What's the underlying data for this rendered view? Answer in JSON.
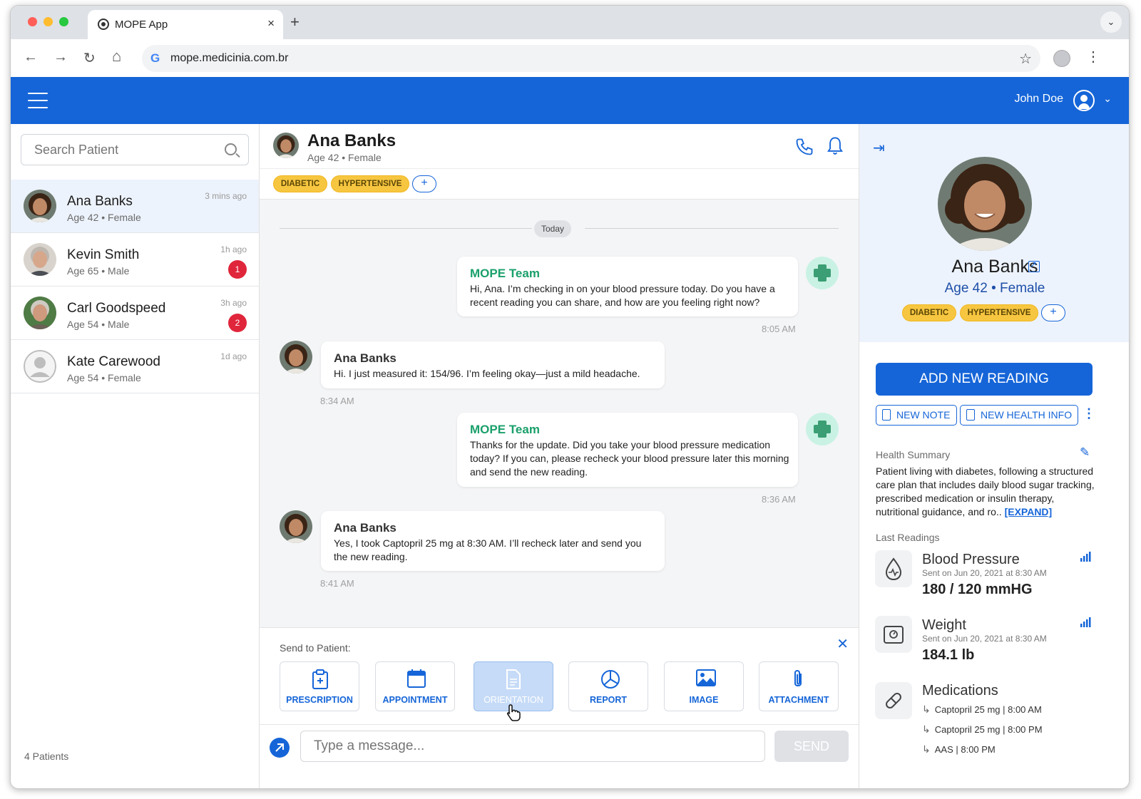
{
  "browser": {
    "tab_title": "MOPE App",
    "tab_close": "×",
    "new_tab": "+",
    "url": "mope.medicinia.com.br",
    "back": "←",
    "forward": "→",
    "reload": "↻",
    "home": "⌂",
    "star": "☆",
    "menu": "⋮",
    "tabs_menu": "⌄"
  },
  "header": {
    "user_name": "John Doe",
    "chevron": "⌄"
  },
  "sidebar": {
    "search": {
      "placeholder": "Search Patient"
    },
    "patients": [
      {
        "name": "Ana Banks",
        "info": "Age 42 • Female",
        "time": "3 mins ago",
        "badge": ""
      },
      {
        "name": "Kevin Smith",
        "info": "Age 65 • Male",
        "time": "1h ago",
        "badge": "1"
      },
      {
        "name": "Carl Goodspeed",
        "info": "Age 54 • Male",
        "time": "3h ago",
        "badge": "2"
      },
      {
        "name": "Kate Carewood",
        "info": "Age 54 • Female",
        "time": "1d ago",
        "badge": ""
      }
    ],
    "count_label": "4 Patients"
  },
  "chat": {
    "patient_name": "Ana Banks",
    "patient_info": "Age 42 • Female",
    "tags": [
      "DIABETIC",
      "HYPERTENSIVE"
    ],
    "tag_add": "+",
    "day_label": "Today",
    "messages": [
      {
        "sender": "MOPE Team",
        "text": "Hi, Ana. I’m checking in on your blood pressure today. Do you have a recent reading you can share, and how are you feeling right now?",
        "time": "8:05 AM"
      },
      {
        "sender": "Ana Banks",
        "text": "Hi. I just measured it: 154/96. I’m feeling okay—just a mild headache.",
        "time": "8:34 AM"
      },
      {
        "sender": "MOPE Team",
        "text": "Thanks for the update. Did you take your blood pressure medication today? If you can, please recheck your blood pressure later this morning and send the new reading.",
        "time": "8:36 AM"
      },
      {
        "sender": "Ana Banks",
        "text": "Yes, I took Captopril 25 mg at 8:30 AM. I’ll recheck later and send you the new reading.",
        "time": "8:41 AM"
      }
    ],
    "send_panel": {
      "label": "Send to Patient:",
      "close": "✕",
      "options": [
        "PRESCRIPTION",
        "APPOINTMENT",
        "ORIENTATION",
        "REPORT",
        "IMAGE",
        "ATTACHMENT"
      ]
    },
    "compose": {
      "placeholder": "Type a message...",
      "send_label": "SEND"
    }
  },
  "profile": {
    "name": "Ana Banks",
    "info": "Age 42 • Female",
    "tags": [
      "DIABETIC",
      "HYPERTENSIVE"
    ],
    "tag_add": "+",
    "collapse": "⇥",
    "add_reading_label": "ADD NEW READING",
    "new_note_label": "NEW NOTE",
    "new_health_info_label": "NEW HEALTH INFO",
    "more": "⋮",
    "health_summary_label": "Health Summary",
    "health_summary_text": "Patient living with diabetes, following a structured care plan that includes daily blood sugar tracking, prescribed medication or insulin therapy, nutritional guidance, and ro..",
    "expand_label": "[EXPAND]",
    "last_readings_label": "Last Readings",
    "readings": [
      {
        "title": "Blood Pressure",
        "sent": "Sent on Jun 20, 2021 at 8:30 AM",
        "value": "180 / 120 mmHG"
      },
      {
        "title": "Weight",
        "sent": "Sent on Jun 20, 2021 at 8:30 AM",
        "value": "184.1 lb"
      }
    ],
    "medications_title": "Medications",
    "medications": [
      "Captopril 25 mg | 8:00 AM",
      "Captopril 25 mg | 8:00 PM",
      "AAS | 8:00 PM"
    ]
  },
  "colors": {
    "primary": "#1565d8",
    "tag": "#f7c640",
    "team_green": "#1aa06b",
    "badge_red": "#e0263b"
  }
}
